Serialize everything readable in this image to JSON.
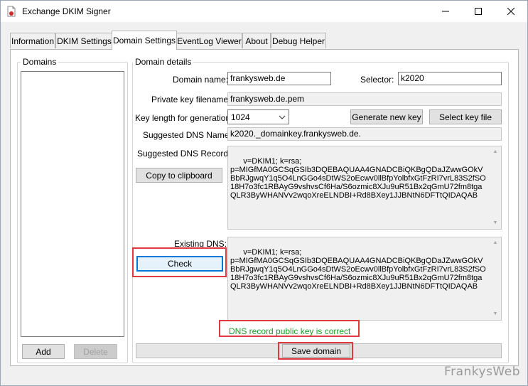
{
  "window": {
    "title": "Exchange DKIM Signer",
    "controls": [
      "minimize",
      "maximize",
      "close"
    ]
  },
  "tabs": [
    {
      "label": "Information",
      "active": false
    },
    {
      "label": "DKIM Settings",
      "active": false
    },
    {
      "label": "Domain Settings",
      "active": true
    },
    {
      "label": "EventLog Viewer",
      "active": false
    },
    {
      "label": "About",
      "active": false
    },
    {
      "label": "Debug Helper",
      "active": false
    }
  ],
  "domains_panel": {
    "title": "Domains",
    "items": [],
    "add_label": "Add",
    "delete_label": "Delete"
  },
  "domain_details": {
    "title": "Domain details",
    "domain_name_label": "Domain name:",
    "domain_name_value": "frankysweb.de",
    "selector_label": "Selector:",
    "selector_value": "k2020",
    "private_key_label": "Private key filename:",
    "private_key_value": "frankysweb.de.pem",
    "key_length_label": "Key length for generation:",
    "key_length_value": "1024",
    "generate_key_label": "Generate new key",
    "select_key_label": "Select key file",
    "suggested_dns_name_label": "Suggested DNS Name:",
    "suggested_dns_name_value": "k2020._domainkey.frankysweb.de.",
    "suggested_dns_record_label": "Suggested DNS Record:",
    "suggested_dns_record_value": "v=DKIM1; k=rsa;\np=MIGfMA0GCSqGSIb3DQEBAQUAA4GNADCBiQKBgQDaJZwwGOkVBbRJgwqY1q5O4LnGGo4sDtWS2oEcwv0llBfpYolbfxGtFzRI7vrL83S2fSO18H7o3fc1RBAyG9vshvsCf6Ha/S6ozmic8XJu9uR51Bx2qGmU72fm8tgaQLR3ByWHANVv2wqoXreELNDBI+Rd8BXey1JJBNtN6DFTtQIDAQAB",
    "copy_clipboard_label": "Copy to clipboard",
    "existing_dns_label": "Existing DNS:",
    "existing_dns_value": "v=DKIM1; k=rsa;\np=MIGfMA0GCSqGSIb3DQEBAQUAA4GNADCBiQKBgQDaJZwwGOkVBbRJgwqY1q5O4LnGGo4sDtWS2oEcwv0llBfpYolbfxGtFzRI7vrL83S2fSO18H7o3fc1RBAyG9vshvsCf6Ha/S6ozmic8XJu9uR51Bx2qGmU72fm8tgaQLR3ByWHANVv2wqoXreELNDBI+Rd8BXey1JJBNtN6DFTtQIDAQAB",
    "check_label": "Check",
    "status_text": "DNS record public key is correct",
    "status_color": "#1b9b2a",
    "save_label": "Save domain"
  },
  "annotation_color": "#e0393e",
  "watermark": "FrankysWeb"
}
